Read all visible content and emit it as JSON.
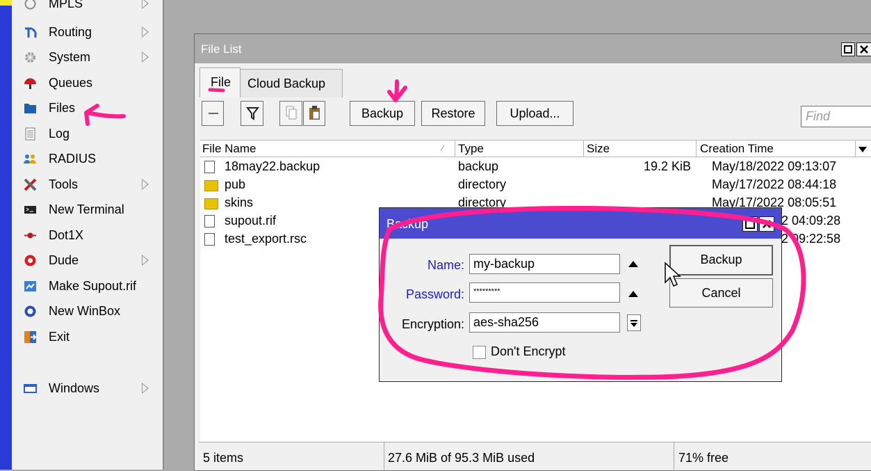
{
  "sidebar": {
    "items": [
      {
        "label": "MPLS",
        "icon": "mpls-icon",
        "submenu": true
      },
      {
        "label": "Routing",
        "icon": "routing-icon",
        "submenu": true
      },
      {
        "label": "System",
        "icon": "system-gear-icon",
        "submenu": true
      },
      {
        "label": "Queues",
        "icon": "queues-icon",
        "submenu": false
      },
      {
        "label": "Files",
        "icon": "folder-icon",
        "submenu": false
      },
      {
        "label": "Log",
        "icon": "log-icon",
        "submenu": false
      },
      {
        "label": "RADIUS",
        "icon": "radius-users-icon",
        "submenu": false
      },
      {
        "label": "Tools",
        "icon": "tools-icon",
        "submenu": true
      },
      {
        "label": "New Terminal",
        "icon": "terminal-icon",
        "submenu": false
      },
      {
        "label": "Dot1X",
        "icon": "dot1x-icon",
        "submenu": false
      },
      {
        "label": "Dude",
        "icon": "dude-icon",
        "submenu": true
      },
      {
        "label": "Make Supout.rif",
        "icon": "supout-icon",
        "submenu": false
      },
      {
        "label": "New WinBox",
        "icon": "winbox-icon",
        "submenu": false
      },
      {
        "label": "Exit",
        "icon": "exit-icon",
        "submenu": false
      },
      {
        "label": "Windows",
        "icon": "windows-icon",
        "submenu": true
      }
    ]
  },
  "file_list": {
    "title": "File List",
    "tabs": [
      "File",
      "Cloud Backup"
    ],
    "toolbar": {
      "backup": "Backup",
      "restore": "Restore",
      "upload": "Upload...",
      "find_placeholder": "Find"
    },
    "columns": [
      "File Name",
      "Type",
      "Size",
      "Creation Time"
    ],
    "rows": [
      {
        "name": "18may22.backup",
        "type": "backup",
        "size": "19.2 KiB",
        "time": "May/18/2022 09:13:07",
        "icon": "document-icon"
      },
      {
        "name": "pub",
        "type": "directory",
        "size": "",
        "time": "May/17/2022 08:44:18",
        "icon": "folder-icon"
      },
      {
        "name": "skins",
        "type": "directory",
        "size": "",
        "time": "May/17/2022 08:05:51",
        "icon": "folder-icon"
      },
      {
        "name": "supout.rif",
        "type": "",
        "size": "",
        "time": "2 04:09:28",
        "icon": "document-icon"
      },
      {
        "name": "test_export.rsc",
        "type": "",
        "size": "",
        "time": "2 09:22:58",
        "icon": "document-icon"
      }
    ],
    "status": {
      "items": "5 items",
      "used": "27.6 MiB of 95.3 MiB used",
      "free": "71% free"
    }
  },
  "backup_dialog": {
    "title": "Backup",
    "name_label": "Name:",
    "name_value": "my-backup",
    "password_label": "Password:",
    "password_value": "*********",
    "encryption_label": "Encryption:",
    "encryption_value": "aes-sha256",
    "dont_encrypt_label": "Don't Encrypt",
    "backup_button": "Backup",
    "cancel_button": "Cancel"
  },
  "colors": {
    "dialog_title": "#4b4bcf",
    "annotation": "#ff1f8e",
    "left_strip": "#2a3ad6",
    "highlight_tag": "#f3e92a",
    "label_blue": "#1a1ad0"
  }
}
